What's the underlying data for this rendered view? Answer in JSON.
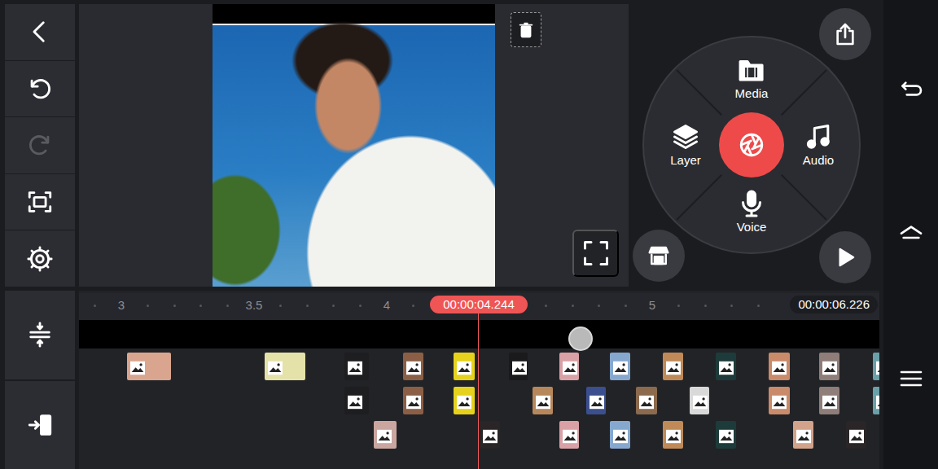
{
  "toolbar": {
    "undo": {
      "disabled": false
    },
    "redo": {
      "disabled": true
    }
  },
  "menu": {
    "items": [
      {
        "label": "Media"
      },
      {
        "label": "Layer"
      },
      {
        "label": "Audio"
      },
      {
        "label": "Voice"
      }
    ]
  },
  "timeline": {
    "playhead": "00:00:04.244",
    "end": "00:00:06.226",
    "ticks": [
      {
        "label": "3",
        "t": 3
      },
      {
        "label": "3.5",
        "t": 3.5
      },
      {
        "label": "4",
        "t": 4
      },
      {
        "label": "5",
        "t": 5
      }
    ],
    "tracks": [
      {
        "clips": [
          {
            "t": 3.02,
            "d": 0.166,
            "color": "#d9a58f"
          },
          {
            "t": 3.54,
            "d": 0.153,
            "color": "#e4e2a8"
          },
          {
            "t": 3.84,
            "d": 0.092,
            "color": "#1e1e20"
          },
          {
            "t": 4.06,
            "d": 0.077,
            "color": "#8b5f45"
          },
          {
            "t": 4.25,
            "d": 0.08,
            "color": "#e6d21c"
          },
          {
            "t": 4.46,
            "d": 0.07,
            "color": "#1a1a1c"
          },
          {
            "t": 4.65,
            "d": 0.074,
            "color": "#d9a1a6"
          },
          {
            "t": 4.84,
            "d": 0.077,
            "color": "#86a8cf"
          },
          {
            "t": 5.04,
            "d": 0.077,
            "color": "#c08a58"
          },
          {
            "t": 5.24,
            "d": 0.077,
            "color": "#1d3b3a"
          },
          {
            "t": 5.44,
            "d": 0.077,
            "color": "#c98b6a"
          },
          {
            "t": 5.63,
            "d": 0.077,
            "color": "#8e7d78"
          },
          {
            "t": 5.83,
            "d": 0.077,
            "color": "#6aa0a8"
          }
        ]
      },
      {
        "clips": [
          {
            "t": 3.84,
            "d": 0.092,
            "color": "#1e1e20"
          },
          {
            "t": 4.06,
            "d": 0.077,
            "color": "#8b5f45"
          },
          {
            "t": 4.25,
            "d": 0.08,
            "color": "#e6d21c"
          },
          {
            "t": 4.55,
            "d": 0.077,
            "color": "#b7875c"
          },
          {
            "t": 4.75,
            "d": 0.074,
            "color": "#3b4f8f"
          },
          {
            "t": 4.94,
            "d": 0.077,
            "color": "#8b6a4e"
          },
          {
            "t": 5.14,
            "d": 0.074,
            "color": "#d9d9d9"
          },
          {
            "t": 5.44,
            "d": 0.077,
            "color": "#c98b6a"
          },
          {
            "t": 5.63,
            "d": 0.077,
            "color": "#8e7d78"
          },
          {
            "t": 5.83,
            "d": 0.077,
            "color": "#6aa0a8"
          }
        ]
      },
      {
        "clips": [
          {
            "t": 3.95,
            "d": 0.086,
            "color": "#c9a6a0"
          },
          {
            "t": 4.35,
            "d": 0.077,
            "color": "#2a2526"
          },
          {
            "t": 4.65,
            "d": 0.074,
            "color": "#d9a1a6"
          },
          {
            "t": 4.84,
            "d": 0.077,
            "color": "#86a8cf"
          },
          {
            "t": 5.04,
            "d": 0.077,
            "color": "#c08a58"
          },
          {
            "t": 5.24,
            "d": 0.077,
            "color": "#1d3b3a"
          },
          {
            "t": 5.53,
            "d": 0.077,
            "color": "#d2a28a"
          },
          {
            "t": 5.73,
            "d": 0.077,
            "color": "#2a2526"
          }
        ]
      }
    ]
  }
}
